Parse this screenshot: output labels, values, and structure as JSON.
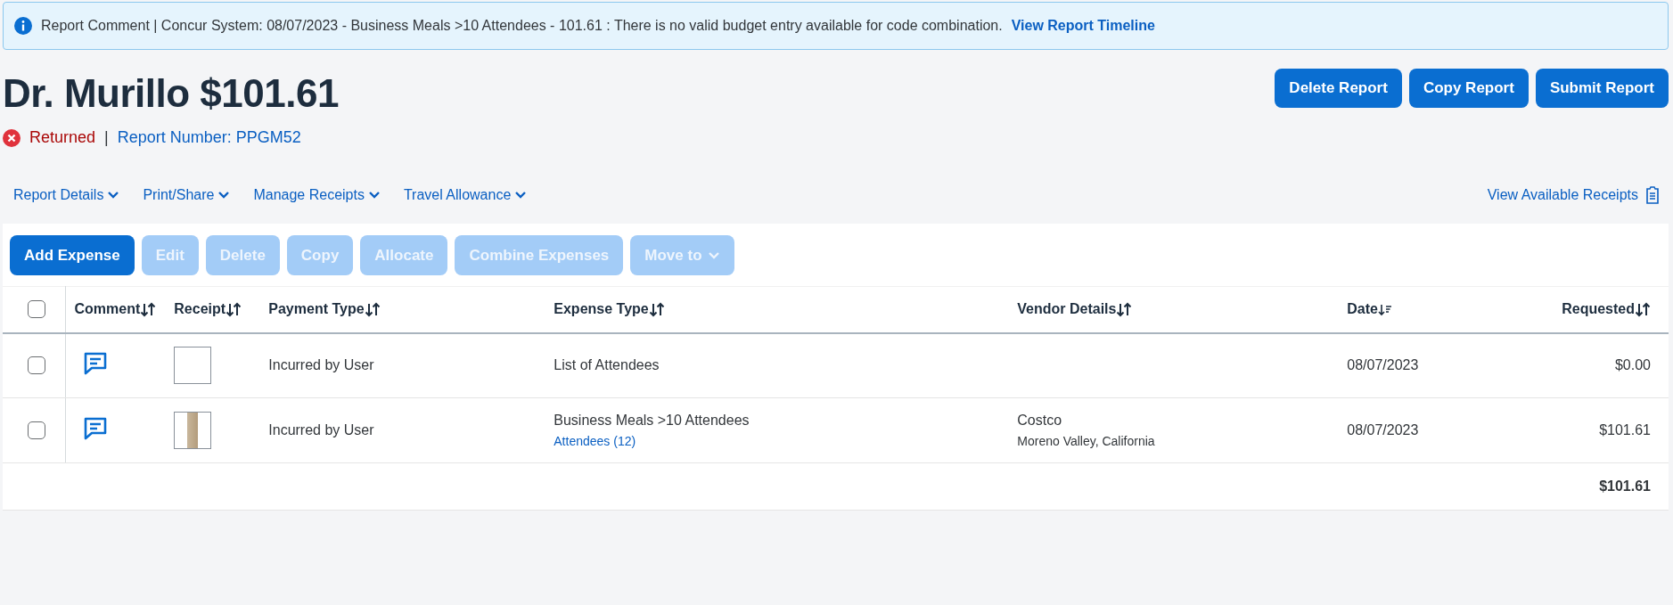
{
  "banner": {
    "message": "Report Comment | Concur System: 08/07/2023 - Business Meals >10 Attendees - 101.61 : There is no valid budget entry available for code combination.",
    "link": "View Report Timeline"
  },
  "header": {
    "title": "Dr. Murillo $101.61",
    "status": "Returned",
    "separator": "|",
    "report_number": "Report Number: PPGM52"
  },
  "actions": [
    "Delete Report",
    "Copy Report",
    "Submit Report"
  ],
  "menus": [
    {
      "label": "Report Details"
    },
    {
      "label": "Print/Share"
    },
    {
      "label": "Manage Receipts"
    },
    {
      "label": "Travel Allowance"
    }
  ],
  "receipts_link": "View Available Receipts",
  "toolbar": [
    {
      "label": "Add Expense",
      "disabled": false,
      "dropdown": false
    },
    {
      "label": "Edit",
      "disabled": true,
      "dropdown": false
    },
    {
      "label": "Delete",
      "disabled": true,
      "dropdown": false
    },
    {
      "label": "Copy",
      "disabled": true,
      "dropdown": false
    },
    {
      "label": "Allocate",
      "disabled": true,
      "dropdown": false
    },
    {
      "label": "Combine Expenses",
      "disabled": true,
      "dropdown": false
    },
    {
      "label": "Move to",
      "disabled": true,
      "dropdown": true
    }
  ],
  "table": {
    "select_all": {
      "checked": false
    },
    "columns": [
      {
        "label": "Comment",
        "sorted": false
      },
      {
        "label": "Receipt",
        "sorted": false
      },
      {
        "label": "Payment Type",
        "sorted": false
      },
      {
        "label": "Expense Type",
        "sorted": false
      },
      {
        "label": "Vendor Details",
        "sorted": false
      },
      {
        "label": "Date",
        "sorted": true
      },
      {
        "label": "Requested",
        "sorted": false
      }
    ],
    "rows": [
      {
        "checked": false,
        "payment_type": "Incurred by User",
        "expense_type": "List of Attendees",
        "date": "08/07/2023",
        "requested": "$0.00"
      },
      {
        "checked": false,
        "payment_type": "Incurred by User",
        "expense_type": "Business Meals >10 Attendees",
        "attendees": "Attendees (12)",
        "vendor": "Costco",
        "location": "Moreno Valley, California",
        "date": "08/07/2023",
        "requested": "$101.61"
      }
    ],
    "total": "$101.61"
  }
}
